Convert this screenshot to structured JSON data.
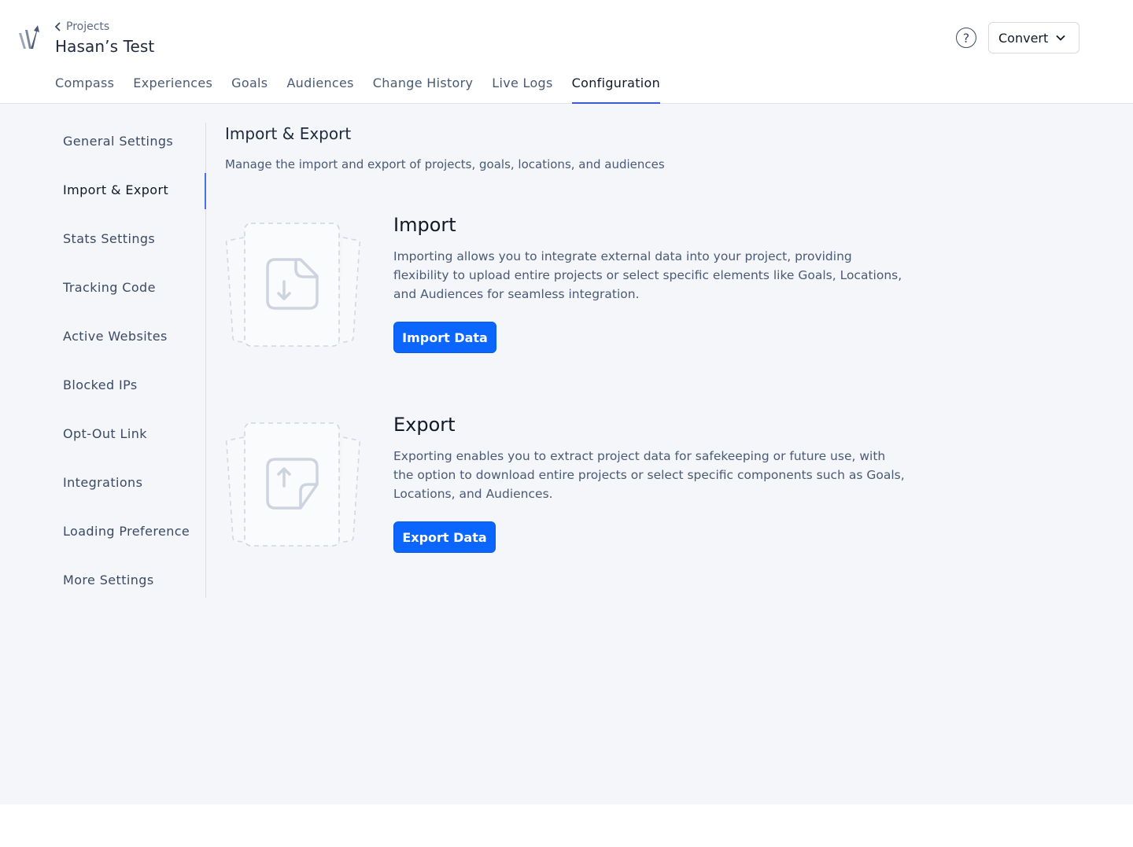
{
  "header": {
    "breadcrumb_label": "Projects",
    "project_title": "Hasan’s Test",
    "help_symbol": "?",
    "account_label": "Convert"
  },
  "tabs": [
    {
      "label": "Compass"
    },
    {
      "label": "Experiences"
    },
    {
      "label": "Goals"
    },
    {
      "label": "Audiences"
    },
    {
      "label": "Change History"
    },
    {
      "label": "Live Logs"
    },
    {
      "label": "Configuration",
      "active": true
    }
  ],
  "sidebar": {
    "items": [
      {
        "label": "General Settings"
      },
      {
        "label": "Import & Export",
        "active": true
      },
      {
        "label": "Stats Settings"
      },
      {
        "label": "Tracking Code"
      },
      {
        "label": "Active Websites"
      },
      {
        "label": "Blocked IPs"
      },
      {
        "label": "Opt-Out Link"
      },
      {
        "label": "Integrations"
      },
      {
        "label": "Loading Preference"
      },
      {
        "label": "More Settings"
      }
    ]
  },
  "main": {
    "title": "Import & Export",
    "description": "Manage the import and export of projects, goals, locations, and audiences",
    "import": {
      "heading": "Import",
      "text": "Importing allows you to integrate external data into your project, providing flexibility to upload entire projects or select specific elements like Goals, Locations, and Audiences for seamless integration.",
      "button_label": "Import Data",
      "icon": "file-import-icon"
    },
    "export": {
      "heading": "Export",
      "text": "Exporting enables you to extract project data for safekeeping or future use, with the option to download entire projects or select specific components such as Goals, Locations, and Audiences.",
      "button_label": "Export Data",
      "icon": "file-export-icon"
    }
  },
  "colors": {
    "accent": "#0a66ff",
    "active_tab_underline": "#3b5bdb",
    "content_background": "#f4f6fa"
  }
}
